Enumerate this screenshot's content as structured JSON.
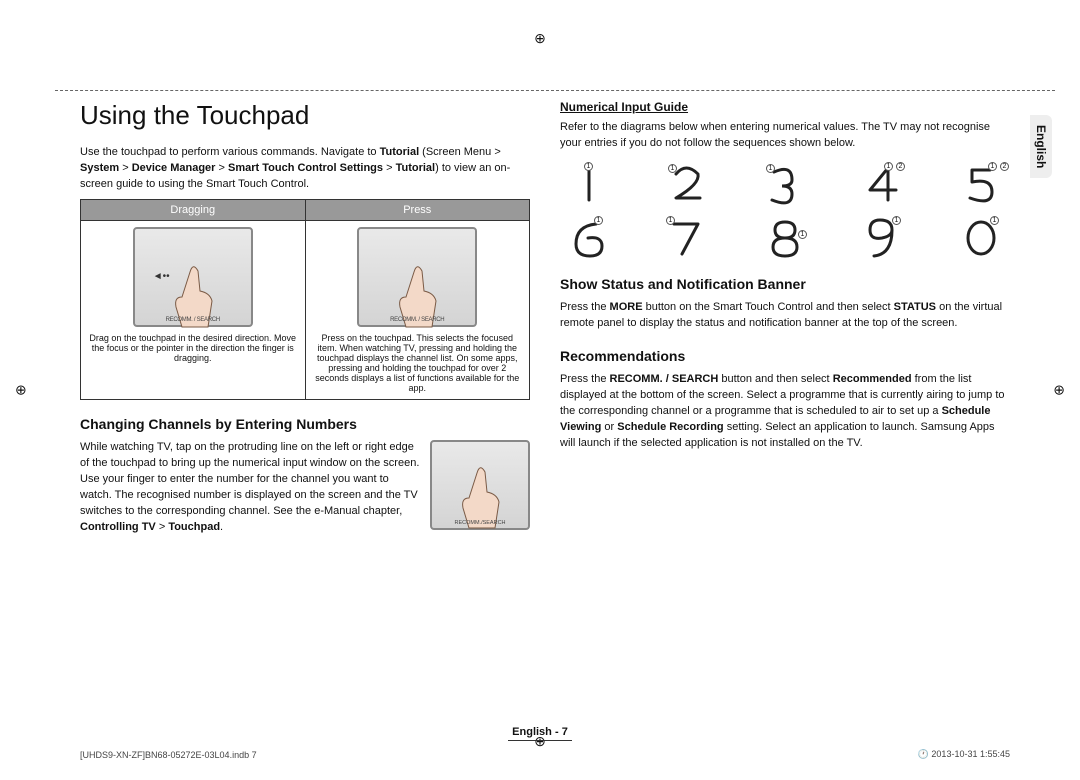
{
  "side_tab": "English",
  "title": "Using the Touchpad",
  "intro": {
    "a": "Use the touchpad to perform various commands. Navigate to ",
    "b": "Tutorial",
    "c": " (Screen Menu > ",
    "d": "System",
    "e": " > ",
    "f": "Device Manager",
    "g": " > ",
    "h": "Smart Touch Control Settings",
    "i": " > ",
    "j": "Tutorial",
    "k": ") to view an on-screen guide to using the Smart Touch Control."
  },
  "table": {
    "h1": "Dragging",
    "h2": "Press",
    "c1": "Drag on the touchpad in the desired direction. Move the focus or the pointer in the direction the finger is dragging.",
    "c2": "Press on the touchpad. This selects the focused item. When watching TV, pressing and holding the touchpad displays the channel list. On some apps, pressing and holding the touchpad for over 2 seconds displays a list of functions available for the app."
  },
  "sec1_h": "Changing Channels by Entering Numbers",
  "sec1_p": {
    "a": "While watching TV, tap on the protruding line on the left or right edge of the touchpad to bring up the numerical input window on the screen. Use your finger to enter the number for the channel you want to watch. The recognised number is displayed on the screen and the TV switches to the corresponding channel. See the e-Manual chapter, ",
    "b": "Controlling TV",
    "c": " > ",
    "d": "Touchpad",
    "e": "."
  },
  "sec2_h": "Numerical Input Guide",
  "sec2_p": "Refer to the diagrams below when entering numerical values. The TV may not recognise your entries if you do not follow the sequences shown below.",
  "sec3_h": "Show Status and Notification Banner",
  "sec3_p": {
    "a": "Press the ",
    "b": "MORE",
    "c": " button on the Smart Touch Control and then select ",
    "d": "STATUS",
    "e": " on the virtual remote panel to display the status and notification banner at the top of the screen."
  },
  "sec4_h": "Recommendations",
  "sec4_p": {
    "a": "Press the ",
    "b": "RECOMM. / SEARCH",
    "c": " button and then select ",
    "d": "Recommended",
    "e": " from the list displayed at the bottom of the screen. Select a programme that is currently airing to jump to the corresponding channel or a programme that is scheduled to air to set up a ",
    "f": "Schedule Viewing",
    "g": " or ",
    "h": "Schedule Recording",
    "i": " setting. Select an application to launch. Samsung Apps will launch if the selected application is not installed on the TV."
  },
  "footer": {
    "lang": "English",
    "page": "7"
  },
  "meta": {
    "file": "[UHDS9-XN-ZF]BN68-05272E-03L04.indb   7",
    "date": "2013-10-31   ",
    "time": "1:55:45"
  }
}
